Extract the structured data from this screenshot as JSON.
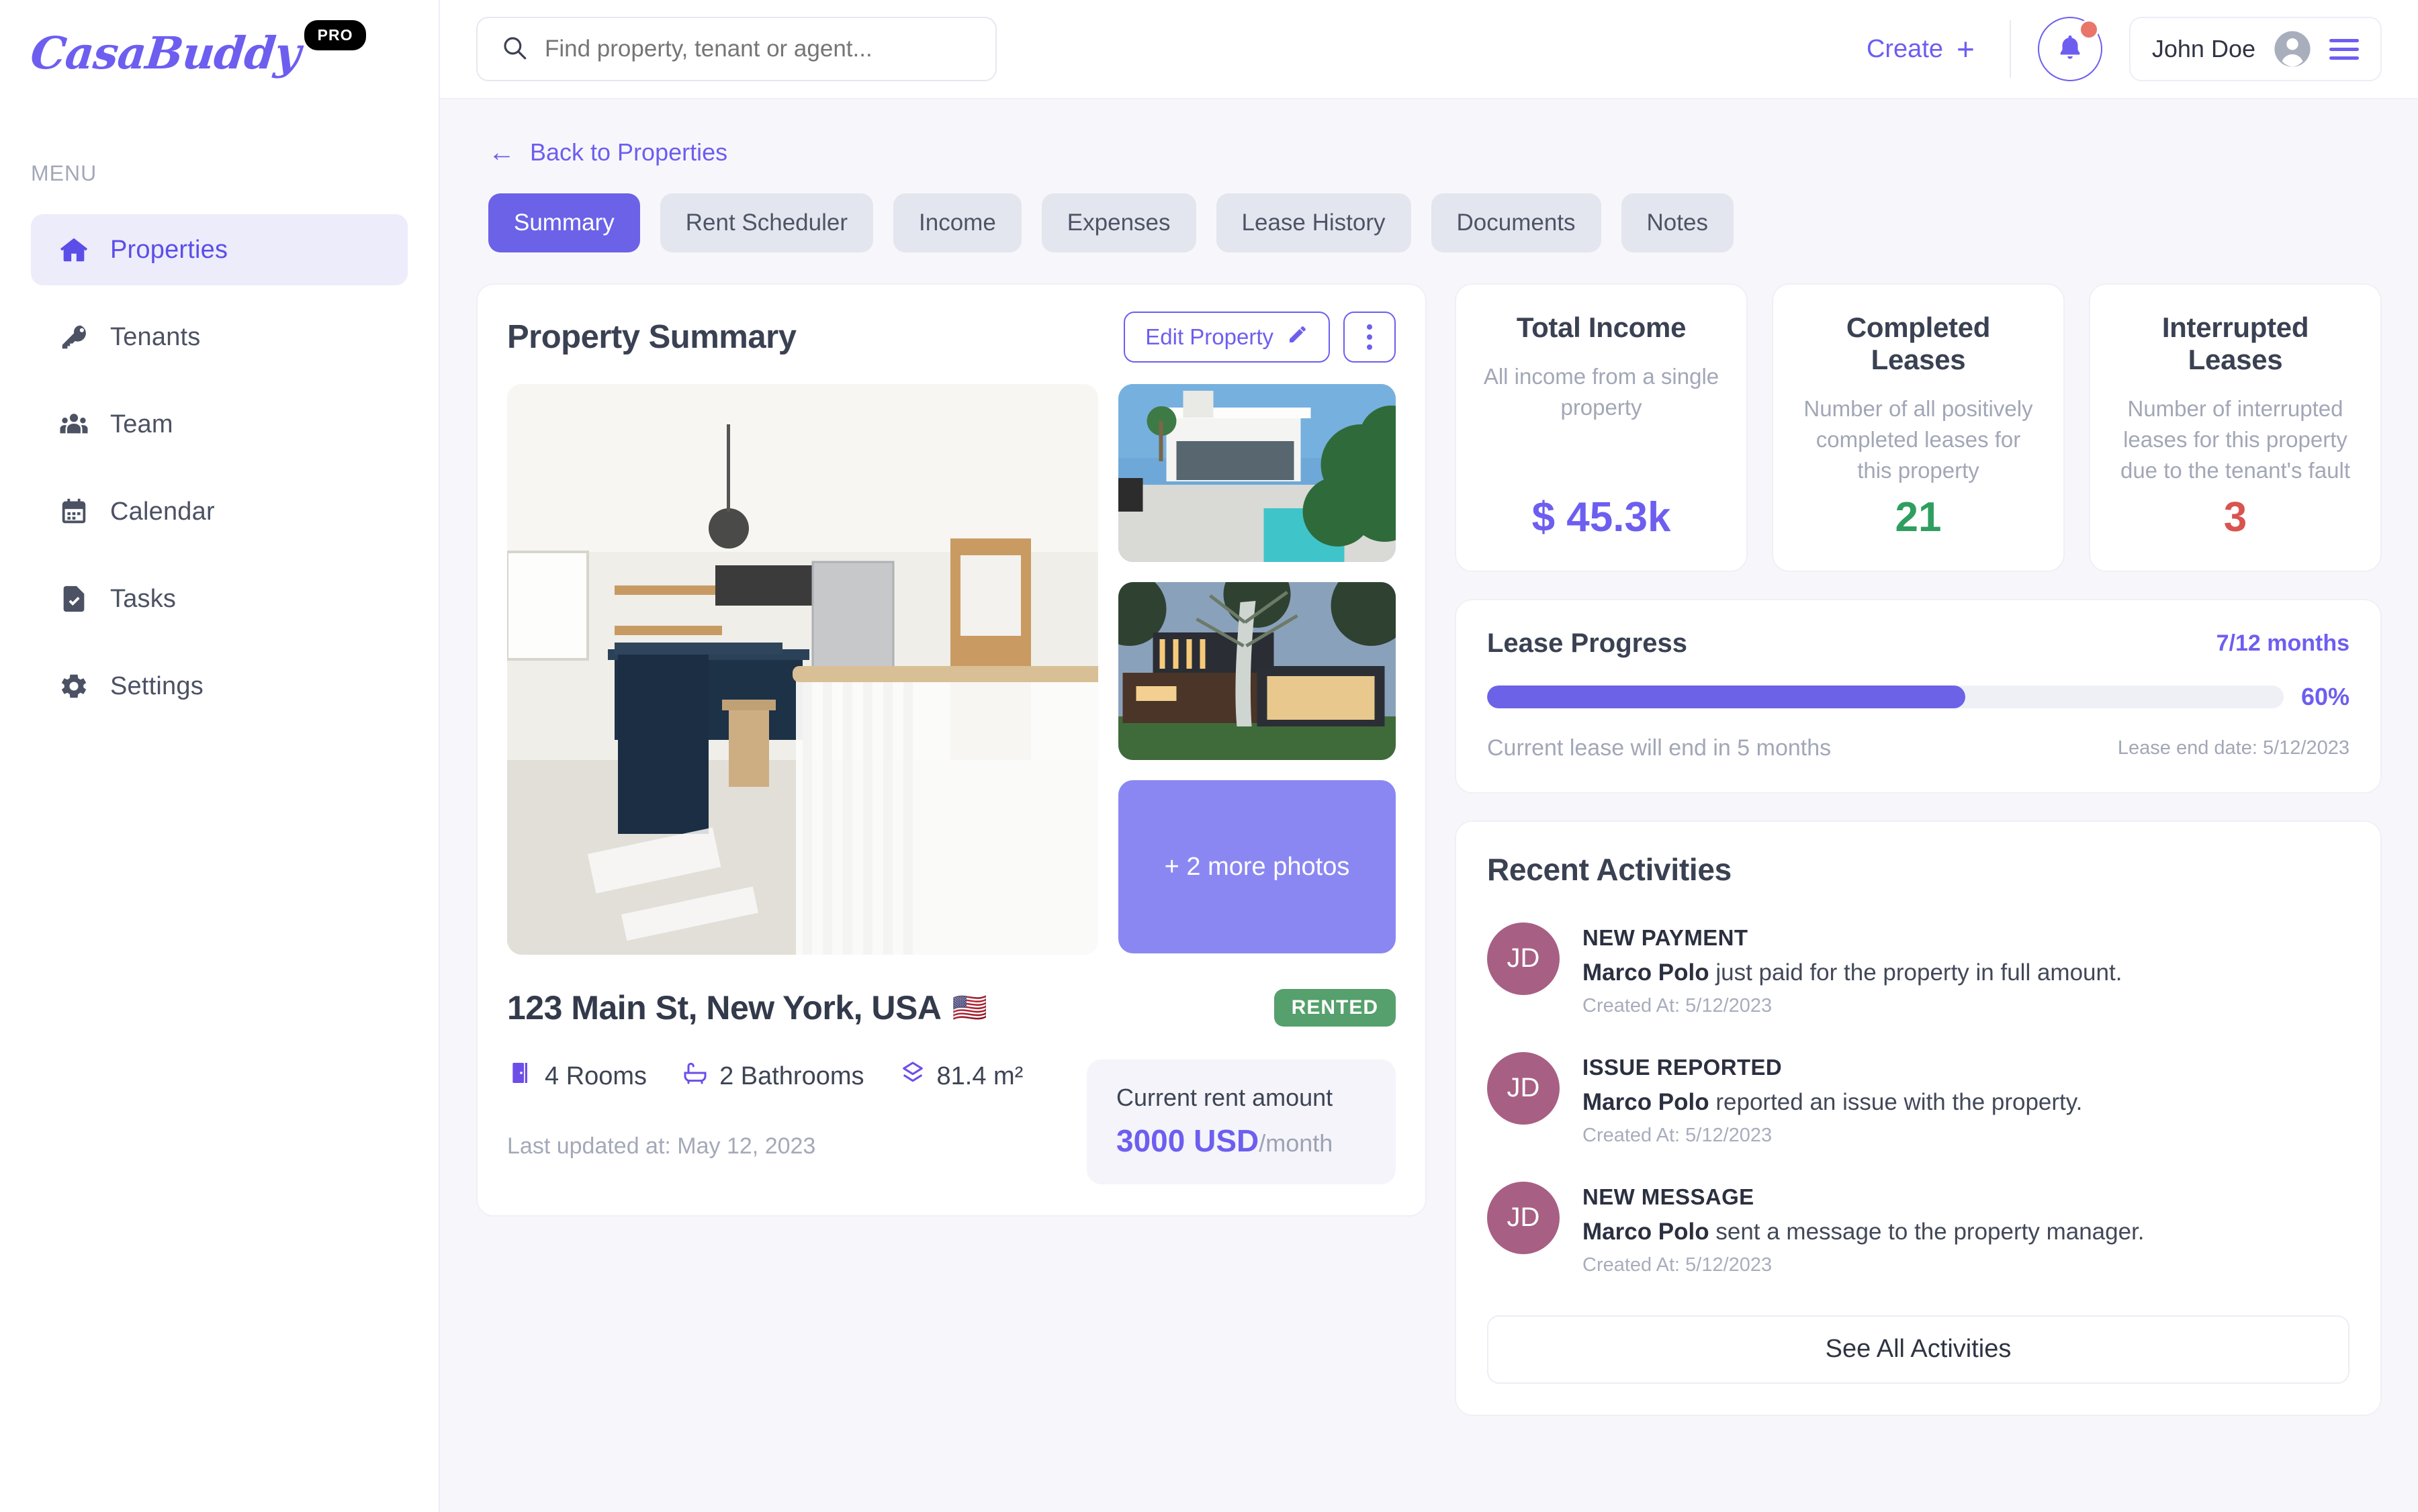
{
  "brand": {
    "name": "CasaBuddy",
    "badge": "PRO"
  },
  "sidebar": {
    "section_label": "MENU",
    "items": [
      {
        "label": "Properties",
        "icon": "home-icon",
        "active": true
      },
      {
        "label": "Tenants",
        "icon": "key-icon",
        "active": false
      },
      {
        "label": "Team",
        "icon": "people-icon",
        "active": false
      },
      {
        "label": "Calendar",
        "icon": "calendar-icon",
        "active": false
      },
      {
        "label": "Tasks",
        "icon": "task-document-icon",
        "active": false
      },
      {
        "label": "Settings",
        "icon": "gear-icon",
        "active": false
      }
    ]
  },
  "topbar": {
    "search_placeholder": "Find property, tenant or agent...",
    "search_value": "",
    "search_icon": "search-icon",
    "create_label": "Create",
    "create_icon": "plus-icon",
    "bell_icon": "bell-icon",
    "has_notification": true,
    "user_name": "John Doe",
    "avatar_icon": "user-avatar-icon",
    "menu_icon": "hamburger-icon"
  },
  "breadcrumb": {
    "back_label": "Back to Properties",
    "back_icon": "arrow-left-icon"
  },
  "tabs": [
    {
      "label": "Summary",
      "active": true
    },
    {
      "label": "Rent Scheduler",
      "active": false
    },
    {
      "label": "Income",
      "active": false
    },
    {
      "label": "Expenses",
      "active": false
    },
    {
      "label": "Lease History",
      "active": false
    },
    {
      "label": "Documents",
      "active": false
    },
    {
      "label": "Notes",
      "active": false
    }
  ],
  "property_summary": {
    "title": "Property Summary",
    "edit_label": "Edit Property",
    "edit_icon": "pencil-icon",
    "kebab_icon": "more-vertical-icon",
    "more_photos_label": "+ 2 more photos",
    "address": "123 Main St, New York, USA",
    "flag": "🇺🇸",
    "status": "RENTED",
    "specs": [
      {
        "value": "4 Rooms",
        "icon": "door-icon"
      },
      {
        "value": "2 Bathrooms",
        "icon": "bathtub-icon"
      },
      {
        "value": "81.4 m²",
        "icon": "area-icon"
      }
    ],
    "last_updated": "Last updated at: May 12, 2023",
    "rent_label": "Current rent amount",
    "rent_amount": "3000 USD",
    "rent_period": "/month"
  },
  "stats": [
    {
      "title": "Total Income",
      "description": "All income from a single property",
      "value": "$ 45.3k",
      "color": "#6d5ef0"
    },
    {
      "title": "Completed Leases",
      "description": "Number of all positively completed leases for this property",
      "value": "21",
      "color": "#2f9e5f"
    },
    {
      "title": "Interrupted Leases",
      "description": "Number of interrupted leases for this property due to the tenant's fault",
      "value": "3",
      "color": "#d9534f"
    }
  ],
  "lease_progress": {
    "title": "Lease Progress",
    "months_label": "7/12 months",
    "percent_label": "60%",
    "percent_value": 60,
    "note": "Current lease will end in 5 months",
    "end_date": "Lease end date: 5/12/2023"
  },
  "recent_activities": {
    "title": "Recent Activities",
    "see_all_label": "See All Activities",
    "items": [
      {
        "initials": "JD",
        "kind": "NEW PAYMENT",
        "actor": "Marco Polo",
        "text": " just paid for the property in full amount.",
        "time": "Created At: 5/12/2023"
      },
      {
        "initials": "JD",
        "kind": "ISSUE REPORTED",
        "actor": "Marco Polo",
        "text": " reported an issue with the property.",
        "time": "Created At: 5/12/2023"
      },
      {
        "initials": "JD",
        "kind": "NEW MESSAGE",
        "actor": "Marco Polo",
        "text": " sent a message to the property manager.",
        "time": "Created At: 5/12/2023"
      }
    ]
  },
  "theme": {
    "accent": "#6d5ef0",
    "accent_dark": "#6b62e8",
    "green": "#55a06c",
    "red": "#d9534f",
    "bg": "#f7f7fb"
  }
}
